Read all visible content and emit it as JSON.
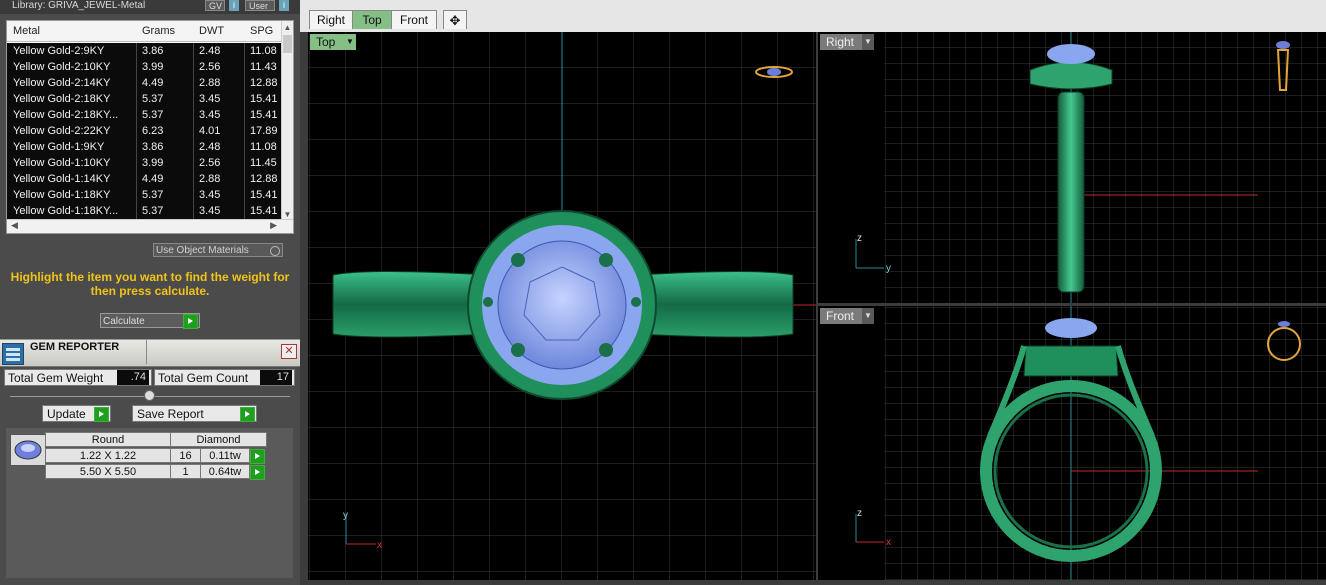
{
  "library": {
    "label": "Library: GRIVA_JEWEL-Metal",
    "btn_gv": "GV",
    "btn_user": "User",
    "info": "i"
  },
  "metal_table": {
    "headers": [
      "Metal",
      "Grams",
      "DWT",
      "SPG"
    ],
    "rows": [
      [
        "Yellow Gold-2:9KY",
        "3.86",
        "2.48",
        "11.08"
      ],
      [
        "Yellow Gold-2:10KY",
        "3.99",
        "2.56",
        "11.43"
      ],
      [
        "Yellow Gold-2:14KY",
        "4.49",
        "2.88",
        "12.88"
      ],
      [
        "Yellow Gold-2:18KY",
        "5.37",
        "3.45",
        "15.41"
      ],
      [
        "Yellow Gold-2:18KY...",
        "5.37",
        "3.45",
        "15.41"
      ],
      [
        "Yellow Gold-2:22KY",
        "6.23",
        "4.01",
        "17.89"
      ],
      [
        "Yellow Gold-1:9KY",
        "3.86",
        "2.48",
        "11.08"
      ],
      [
        "Yellow Gold-1:10KY",
        "3.99",
        "2.56",
        "11.45"
      ],
      [
        "Yellow Gold-1:14KY",
        "4.49",
        "2.88",
        "12.88"
      ],
      [
        "Yellow Gold-1:18KY",
        "5.37",
        "3.45",
        "15.41"
      ],
      [
        "Yellow Gold-1:18KY...",
        "5.37",
        "3.45",
        "15.41"
      ]
    ]
  },
  "use_object_materials": "Use Object Materials",
  "hint": "Highlight the item you want to find the weight for then press calculate.",
  "calculate_label": "Calculate",
  "gem_reporter": {
    "title": "GEM REPORTER",
    "total_weight_label": "Total Gem Weight",
    "total_weight_value": ".74",
    "total_count_label": "Total Gem Count",
    "total_count_value": "17",
    "update_label": "Update",
    "save_report_label": "Save Report",
    "headers": [
      "Round",
      "Diamond"
    ],
    "gems": [
      {
        "size": "1.22 X 1.22",
        "count": "16",
        "weight": "0.11tw"
      },
      {
        "size": "5.50 X 5.50",
        "count": "1",
        "weight": "0.64tw"
      }
    ]
  },
  "view_tabs": [
    "Right",
    "Top",
    "Front"
  ],
  "active_tab": "Top",
  "add_tab_icon": "plus-icon",
  "viewports": {
    "top_label": "Top",
    "right_label": "Right",
    "front_label": "Front"
  },
  "axes": {
    "x": "x",
    "y": "y",
    "z": "z"
  },
  "colors": {
    "ring_green": "#2fa36e",
    "gem_blue": "#8aa6ef",
    "grid": "#3a3a3a",
    "axis_cyan": "#2c8d9a",
    "axis_red": "#c0282a",
    "tab_active": "#86bf86",
    "hint_yellow": "#f0c419"
  }
}
